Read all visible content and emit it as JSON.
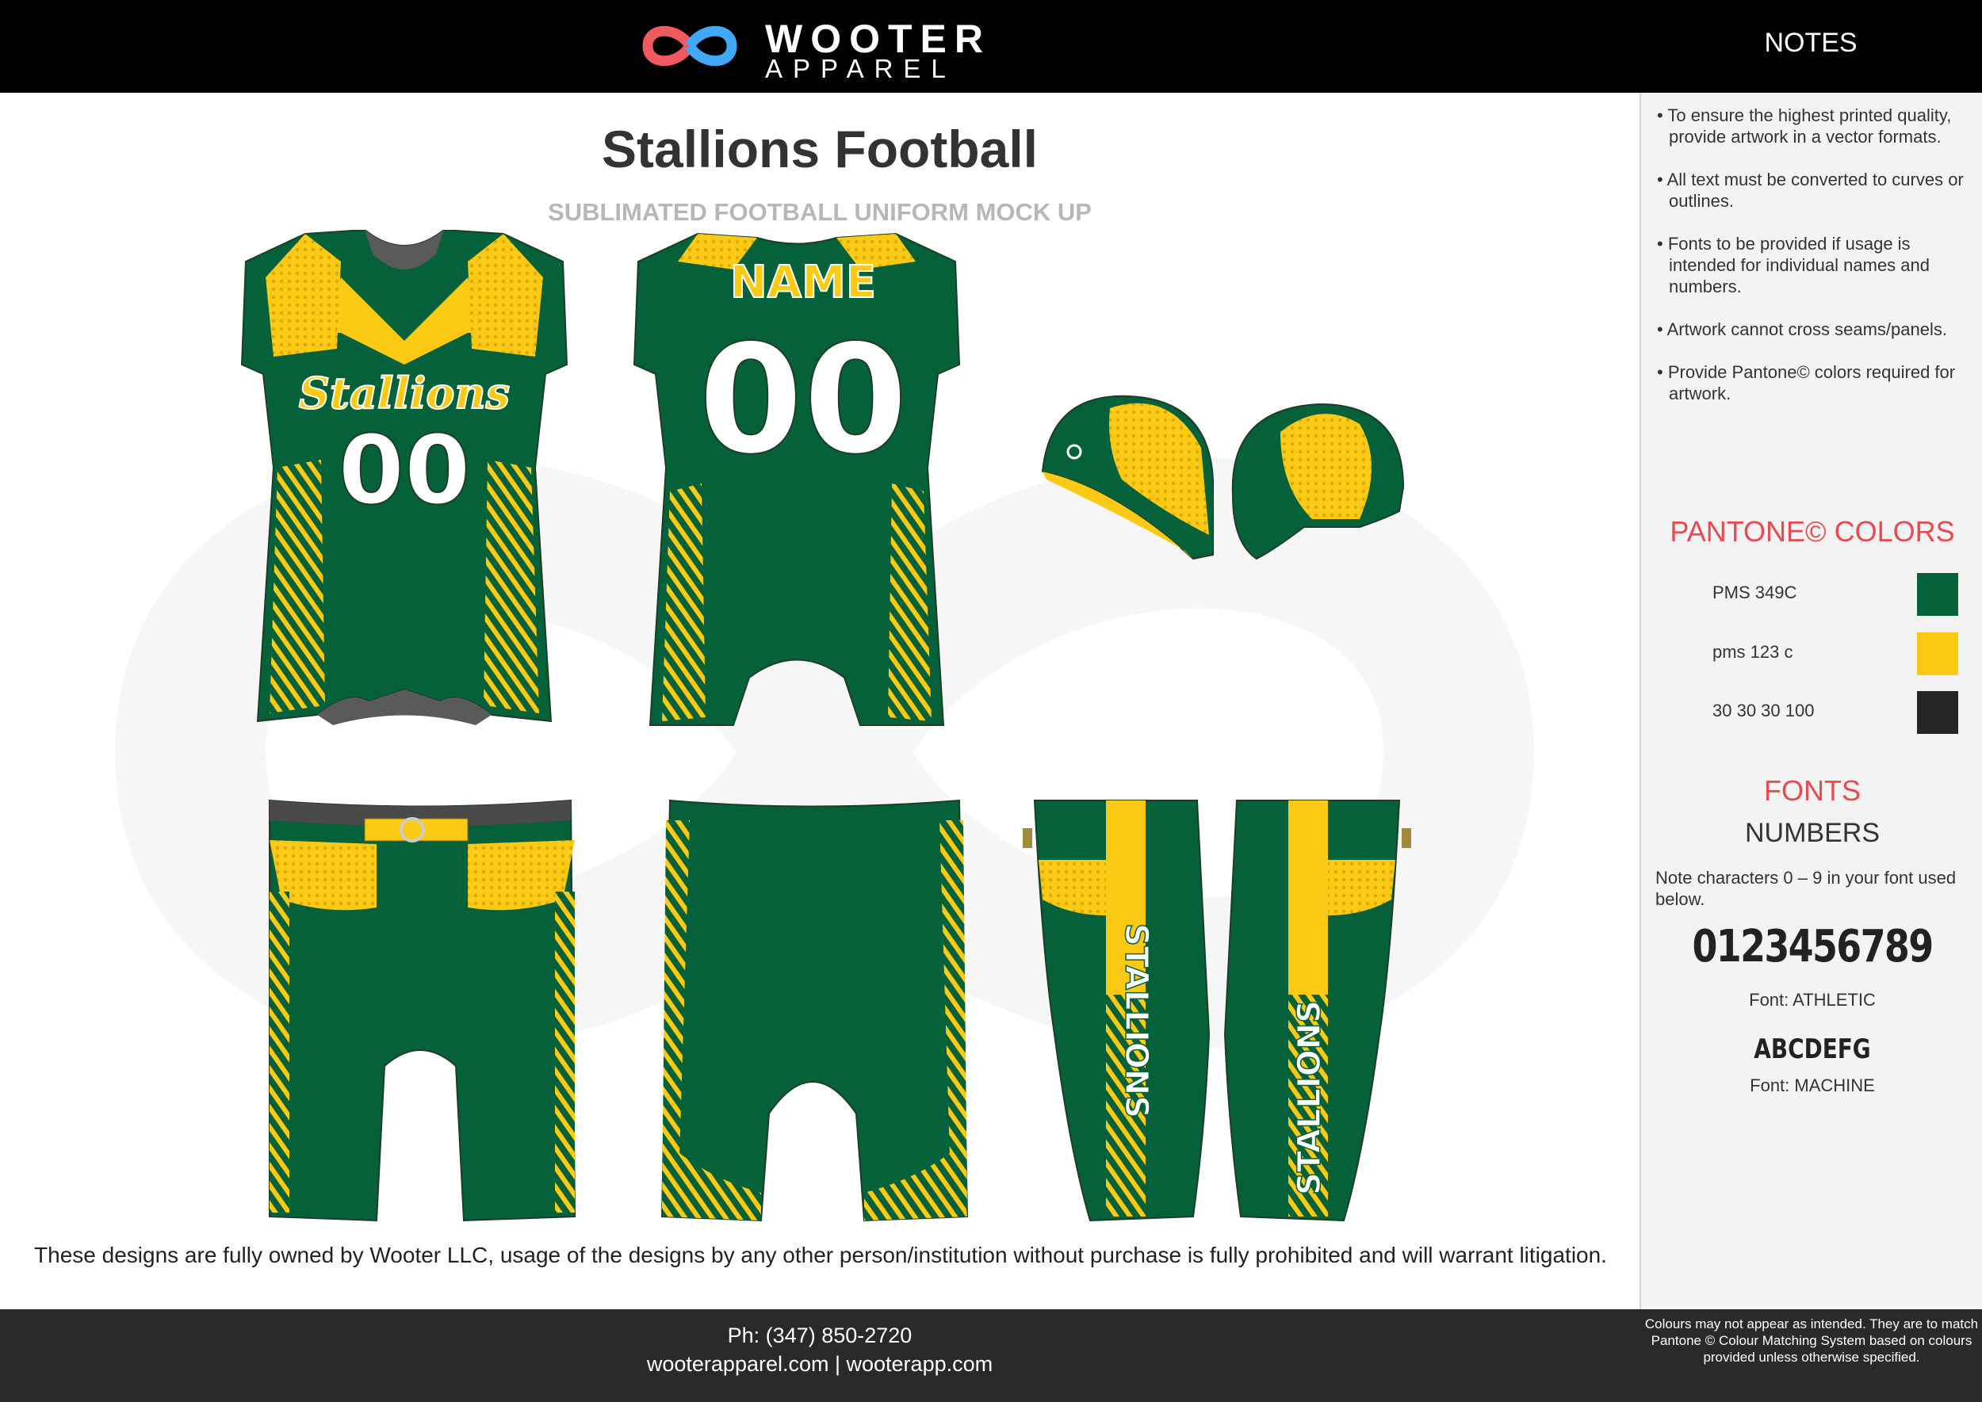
{
  "header": {
    "brand_line1": "WOOTER",
    "brand_line2": "APPAREL",
    "notes_title": "NOTES"
  },
  "title": "Stallions Football",
  "subtitle": "SUBLIMATED FOOTBALL UNIFORM MOCK UP",
  "garments": {
    "jersey_front": {
      "script_text": "Stallions",
      "number": "00"
    },
    "jersey_back": {
      "name": "NAME",
      "number": "00"
    },
    "pants_side_text": "STALLIONS"
  },
  "notes": [
    "• To ensure the highest printed quality, provide artwork in  a vector formats.",
    "• All text must be converted to curves or outlines.",
    "• Fonts to be provided if usage is intended for individual names and numbers.",
    "• Artwork cannot cross seams/panels.",
    "• Provide Pantone© colors required for artwork."
  ],
  "pantone": {
    "heading": "PANTONE©  COLORS",
    "colors": [
      {
        "label": "PMS 349C",
        "hex": "#05613a"
      },
      {
        "label": "pms 123 c",
        "hex": "#fcc915"
      },
      {
        "label": "30 30 30 100",
        "hex": "#262626"
      }
    ]
  },
  "fonts": {
    "heading": "FONTS",
    "numbers_title": "NUMBERS",
    "note": "Note characters 0 – 9 in your font used below.",
    "sample1": "0123456789",
    "label1": "Font: ATHLETIC",
    "sample2": "ABCDEFG",
    "label2": "Font: MACHINE"
  },
  "copyright": "These designs are fully owned by Wooter LLC, usage of the designs by any other person/institution without purchase is fully prohibited and will warrant litigation.",
  "footer": {
    "phone": "Ph: (347) 850-2720",
    "web": "wooterapparel.com | wooterapp.com"
  },
  "sidebar_disclaimer": "Colours may not appear as intended. They are to match Pantone © Colour Matching System based on colours provided unless otherwise specified.",
  "colors": {
    "green": "#05613a",
    "yellow": "#fcc915",
    "dark": "#262626",
    "accent_red": "#e84a4f"
  }
}
